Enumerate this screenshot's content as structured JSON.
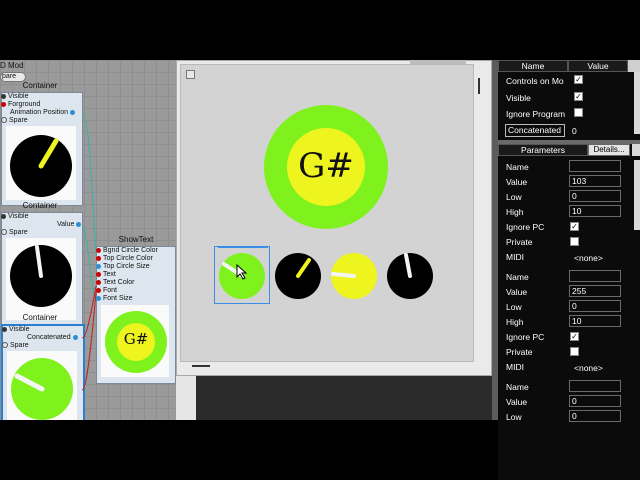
{
  "node_editor": {
    "mod_label": "D Mod",
    "spare_button": "pare",
    "container1": {
      "title": "Container",
      "ports": [
        "Visible",
        "Forground",
        "Animation Position",
        "Spare"
      ]
    },
    "container2": {
      "title": "Container",
      "ports": [
        "Visible",
        "Value",
        "Spare"
      ]
    },
    "container3": {
      "title": "Container",
      "ports": [
        "Visible",
        "Concatenated",
        "Spare"
      ]
    },
    "showtext": {
      "title": "ShowText",
      "ports": [
        "Bgnd Circle Color",
        "Top Circle Color",
        "Top Circle Size",
        "Text",
        "Text Color",
        "Font",
        "Font Size"
      ],
      "preview_text": "G#"
    }
  },
  "preview": {
    "note_text": "G#"
  },
  "properties": {
    "header_name": "Name",
    "header_value": "Value",
    "rows": [
      {
        "name": "Controls on Mo",
        "checked": true
      },
      {
        "name": "Visible",
        "checked": true
      },
      {
        "name": "Ignore Program",
        "checked": false
      }
    ],
    "concatenated_label": "Concatenated",
    "concatenated_value": "0",
    "tab_parameters": "Parameters",
    "tab_details": "Details...",
    "param_groups": [
      {
        "name_label": "Name",
        "name_value": "",
        "value_label": "Value",
        "value": "103",
        "low_label": "Low",
        "low": "0",
        "high_label": "High",
        "high": "10",
        "ignore_pc_label": "Ignore PC",
        "ignore_pc": true,
        "private_label": "Private",
        "private": false,
        "midi_label": "MIDI",
        "midi": "<none>"
      },
      {
        "name_label": "Name",
        "name_value": "",
        "value_label": "Value",
        "value": "255",
        "low_label": "Low",
        "low": "0",
        "high_label": "High",
        "high": "10",
        "ignore_pc_label": "Ignore PC",
        "ignore_pc": true,
        "private_label": "Private",
        "private": false,
        "midi_label": "MIDI",
        "midi": "<none>"
      },
      {
        "name_label": "Name",
        "name_value": "",
        "value_label": "Value",
        "value": "0",
        "low_label": "Low",
        "low": "0"
      }
    ]
  },
  "colors": {
    "green": "#7ff21e",
    "yellow": "#eef41e",
    "black": "#000000",
    "select": "#3a8ee8"
  }
}
